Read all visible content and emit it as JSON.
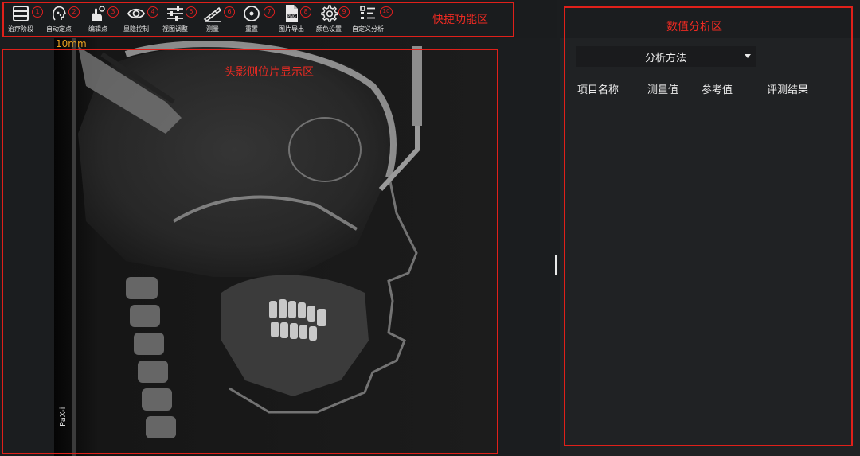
{
  "toolbar": {
    "tools": [
      {
        "label": "治疗阶段",
        "num": "1",
        "icon": "list-icon"
      },
      {
        "label": "自动定点",
        "num": "2",
        "icon": "face-scan-icon"
      },
      {
        "label": "编辑点",
        "num": "3",
        "icon": "hand-edit-icon"
      },
      {
        "label": "显隐控制",
        "num": "4",
        "icon": "eye-icon"
      },
      {
        "label": "视图调整",
        "num": "5",
        "icon": "sliders-icon"
      },
      {
        "label": "测量",
        "num": "6",
        "icon": "ruler-icon"
      },
      {
        "label": "重置",
        "num": "7",
        "icon": "reset-icon"
      },
      {
        "label": "图片导出",
        "num": "8",
        "icon": "png-export-icon"
      },
      {
        "label": "颜色设置",
        "num": "9",
        "icon": "gear-icon"
      },
      {
        "label": "自定义分析",
        "num": "10",
        "icon": "custom-list-icon"
      }
    ]
  },
  "annotations": {
    "toolbar_area": "快捷功能区",
    "image_area": "头影侧位片显示区",
    "analysis_area": "数值分析区"
  },
  "viewer": {
    "scale_label": "10mm",
    "device_label": "PaX-i"
  },
  "analysis": {
    "method_label": "分析方法",
    "columns": [
      "项目名称",
      "测量值",
      "参考值",
      "评测结果"
    ],
    "rows": []
  },
  "colors": {
    "annotation_red": "#e0201a",
    "background": "#1b1d1f",
    "panel": "#202224",
    "scale_orange": "#e8a020"
  }
}
